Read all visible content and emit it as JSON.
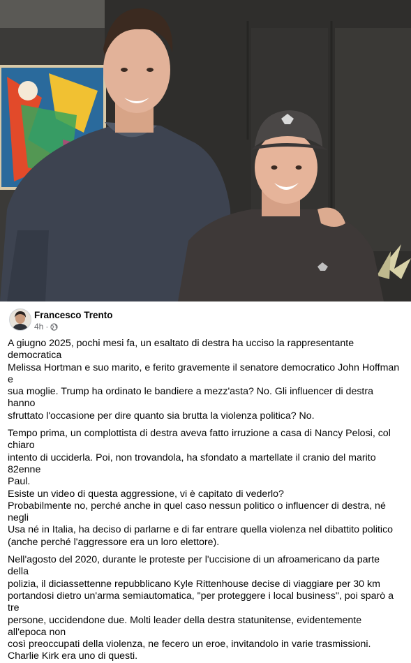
{
  "post": {
    "author": "Francesco Trento",
    "time": "4h",
    "separator": "·",
    "privacy_icon": "globe-icon",
    "photo": "photo-of-two-men-smiling",
    "paragraphs": [
      "A giugno 2025, pochi mesi fa, un esaltato di destra ha ucciso la rappresentante democratica\nMelissa Hortman e suo marito, e ferito gravemente il senatore democratico John Hoffman e\nsua moglie. Trump ha ordinato le bandiere a mezz'asta? No. Gli influencer di destra hanno\nsfruttato l'occasione per dire quanto sia brutta la violenza politica? No.",
      "Tempo prima, un complottista di destra aveva fatto irruzione a casa di Nancy Pelosi, col chiaro\nintento di ucciderla. Poi, non trovandola, ha sfondato a martellate il cranio del marito 82enne\nPaul.",
      "Esiste un video di questa aggressione, vi è capitato di vederlo?",
      "Probabilmente no, perché anche in quel caso nessun politico o influencer di destra, né negli\nUsa né in Italia, ha deciso di parlarne e di far entrare quella violenza nel dibattito politico\n(anche perché l'aggressore era un loro elettore).",
      "Nell'agosto del 2020, durante le proteste per l'uccisione di un afroamericano da parte della\npolizia, il diciassettenne repubblicano Kyle Rittenhouse decise di viaggiare per 30 km\nportandosi dietro un'arma semiautomatica, \"per proteggere i local business\", poi sparò a tre\npersone, uccidendone due. Molti leader della destra statunitense, evidentemente all'epoca non\ncosì preoccupati della violenza, ne fecero un eroe, invitandolo in varie trasmissioni.",
      "Charlie Kirk era uno di questi."
    ]
  }
}
